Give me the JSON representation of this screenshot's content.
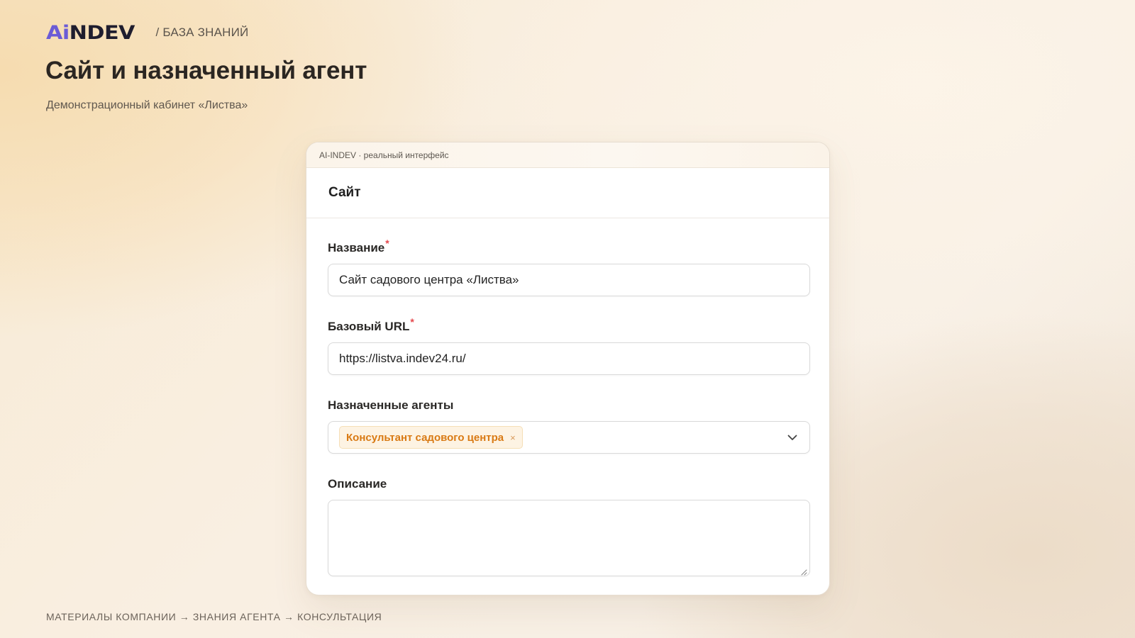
{
  "brand": {
    "logo_ai": "Ai",
    "logo_rest": "NDEV",
    "section": "/ БАЗА ЗНАНИЙ"
  },
  "page": {
    "title": "Сайт и назначенный агент",
    "subtitle": "Демонстрационный кабинет «Листва»"
  },
  "frame": {
    "caption": "AI-INDEV · реальный интерфейс"
  },
  "form": {
    "title": "Сайт",
    "required_mark": "*",
    "name": {
      "label": "Название",
      "value": "Сайт садового центра «Листва»"
    },
    "url": {
      "label": "Базовый URL",
      "value": "https://listva.indev24.ru/"
    },
    "agents": {
      "label": "Назначенные агенты",
      "selected": [
        "Консультант садового центра"
      ],
      "remove_glyph": "×"
    },
    "description": {
      "label": "Описание",
      "value": ""
    }
  },
  "footer": {
    "path": "МАТЕРИАЛЫ КОМПАНИИ → ЗНАНИЯ АГЕНТА → КОНСУЛЬТАЦИЯ"
  },
  "colors": {
    "accent_tag_text": "#d97a14",
    "accent_tag_bg": "#fdf3e3",
    "required": "#e5484d",
    "logo_ai": "#6b5bd6",
    "logo_dark": "#1f1d2e"
  },
  "icons": {
    "select_toggle": "chevron-down-icon",
    "tag_remove": "close-icon",
    "textarea_resize": "resize-handle-icon"
  }
}
